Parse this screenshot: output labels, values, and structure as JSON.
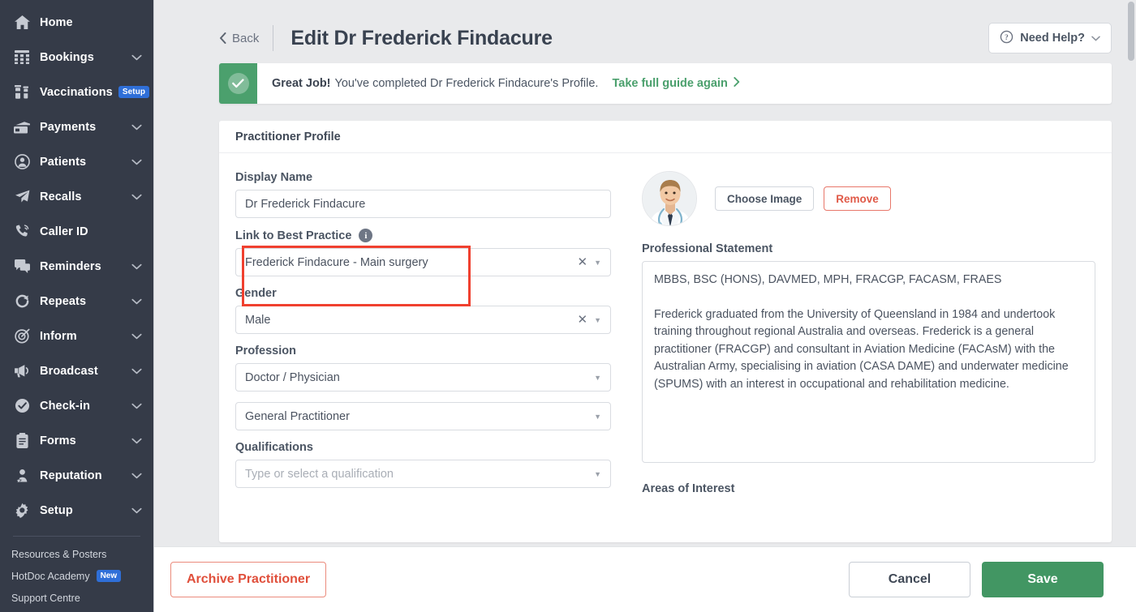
{
  "sidebar": {
    "items": [
      {
        "label": "Home",
        "icon": "home-icon",
        "caret": false,
        "badge": null
      },
      {
        "label": "Bookings",
        "icon": "calendar-icon",
        "caret": true,
        "badge": null
      },
      {
        "label": "Vaccinations",
        "icon": "vial-icon",
        "caret": false,
        "badge": "Setup"
      },
      {
        "label": "Payments",
        "icon": "card-icon",
        "caret": true,
        "badge": null
      },
      {
        "label": "Patients",
        "icon": "person-circle-icon",
        "caret": true,
        "badge": null
      },
      {
        "label": "Recalls",
        "icon": "paper-plane-icon",
        "caret": true,
        "badge": null
      },
      {
        "label": "Caller ID",
        "icon": "phone-icon",
        "caret": false,
        "badge": null
      },
      {
        "label": "Reminders",
        "icon": "chat-icon",
        "caret": true,
        "badge": null
      },
      {
        "label": "Repeats",
        "icon": "refresh-icon",
        "caret": true,
        "badge": null
      },
      {
        "label": "Inform",
        "icon": "target-icon",
        "caret": true,
        "badge": null
      },
      {
        "label": "Broadcast",
        "icon": "megaphone-icon",
        "caret": true,
        "badge": null
      },
      {
        "label": "Check-in",
        "icon": "check-circle-icon",
        "caret": true,
        "badge": null
      },
      {
        "label": "Forms",
        "icon": "clipboard-icon",
        "caret": true,
        "badge": null
      },
      {
        "label": "Reputation",
        "icon": "star-person-icon",
        "caret": true,
        "badge": null
      },
      {
        "label": "Setup",
        "icon": "gear-icon",
        "caret": true,
        "badge": null
      }
    ],
    "footer_links": [
      {
        "label": "Resources & Posters",
        "badge": null
      },
      {
        "label": "HotDoc Academy",
        "badge": "New"
      },
      {
        "label": "Support Centre",
        "badge": null
      }
    ]
  },
  "header": {
    "back_label": "Back",
    "title": "Edit Dr Frederick Findacure",
    "need_help_label": "Need Help?"
  },
  "banner": {
    "strong": "Great Job!",
    "message": "You've completed Dr Frederick Findacure's Profile.",
    "link_label": "Take full guide again"
  },
  "card": {
    "title": "Practitioner Profile",
    "fields": {
      "display_name": {
        "label": "Display Name",
        "value": "Dr Frederick Findacure"
      },
      "link_best_practice": {
        "label": "Link to Best Practice",
        "value": "Frederick Findacure - Main surgery",
        "info_glyph": "i"
      },
      "gender": {
        "label": "Gender",
        "value": "Male"
      },
      "profession": {
        "label": "Profession",
        "value": "Doctor / Physician",
        "value_secondary": "General Practitioner"
      },
      "qualifications": {
        "label": "Qualifications",
        "placeholder": "Type or select a qualification",
        "value": ""
      }
    },
    "image": {
      "choose_label": "Choose Image",
      "remove_label": "Remove"
    },
    "professional_statement": {
      "label": "Professional Statement",
      "paragraph_1": "MBBS, BSC (HONS), DAVMED, MPH, FRACGP, FACASM, FRAES",
      "paragraph_2": "Frederick graduated from the University of Queensland in 1984 and undertook training throughout regional Australia and overseas. Frederick is a general practitioner (FRACGP) and consultant in Aviation Medicine (FACAsM) with the Australian Army, specialising in aviation (CASA DAME) and underwater medicine (SPUMS) with an interest in occupational and rehabilitation medicine."
    },
    "areas_of_interest_label": "Areas of Interest"
  },
  "bottom_bar": {
    "archive_label": "Archive Practitioner",
    "cancel_label": "Cancel",
    "save_label": "Save"
  },
  "colors": {
    "sidebar_bg": "#353b48",
    "accent_blue": "#2f6fd8",
    "success_green": "#4ba06d",
    "save_green": "#429663",
    "danger_red": "#e04f3b",
    "annotation_red": "#f0402f",
    "page_bg": "#e9eaec"
  }
}
